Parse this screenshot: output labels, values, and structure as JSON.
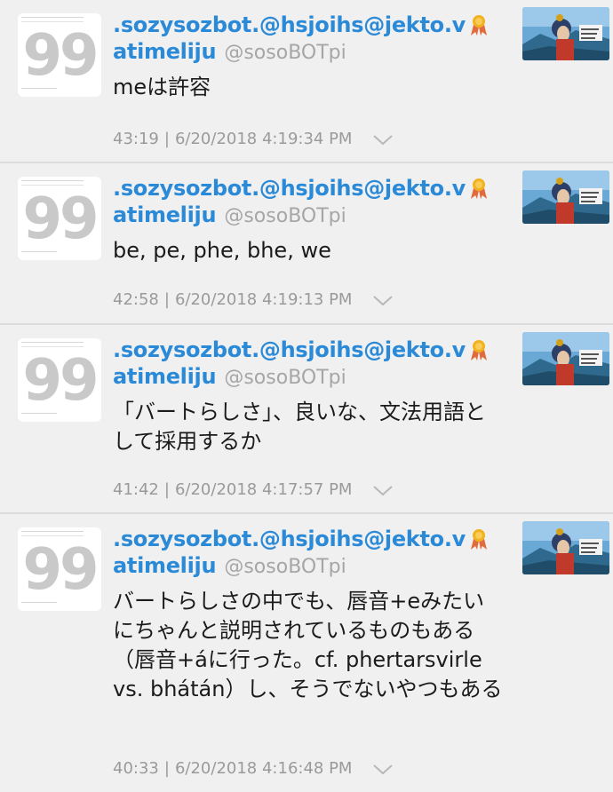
{
  "tweets": [
    {
      "display_name": ".sozysozbot.@hsjoihs@jekto.v",
      "user_name": "atimeliju",
      "handle": "@sosoBOTpi",
      "text": "meは許容",
      "relative_time": "43:19",
      "separator": "|",
      "timestamp": "6/20/2018 4:19:34 PM"
    },
    {
      "display_name": ".sozysozbot.@hsjoihs@jekto.v",
      "user_name": "atimeliju",
      "handle": "@sosoBOTpi",
      "text": "be, pe, phe, bhe, we",
      "relative_time": "42:58",
      "separator": "|",
      "timestamp": "6/20/2018 4:19:13 PM"
    },
    {
      "display_name": ".sozysozbot.@hsjoihs@jekto.v",
      "user_name": "atimeliju",
      "handle": "@sosoBOTpi",
      "text": "「バートらしさ」、良いな、文法用語として採用するか",
      "relative_time": "41:42",
      "separator": "|",
      "timestamp": "6/20/2018 4:17:57 PM"
    },
    {
      "display_name": ".sozysozbot.@hsjoihs@jekto.v",
      "user_name": "atimeliju",
      "handle": "@sosoBOTpi",
      "text": "バートらしさの中でも、唇音+eみたいにちゃんと説明されているものもある（唇音+áに行った。cf. phertarsvirle vs. bhátán）し、そうでないやつもある",
      "relative_time": "40:33",
      "separator": "|",
      "timestamp": "6/20/2018 4:16:48 PM"
    }
  ],
  "icons": {
    "avatar_text": "99",
    "badge": "award-ribbon-icon",
    "chevron": "chevron-down-icon"
  },
  "colors": {
    "name_blue": "#2b8ad8",
    "handle_gray": "#a6a6a6",
    "background": "#f0f0f0",
    "badge_gold": "#f2b11f"
  }
}
